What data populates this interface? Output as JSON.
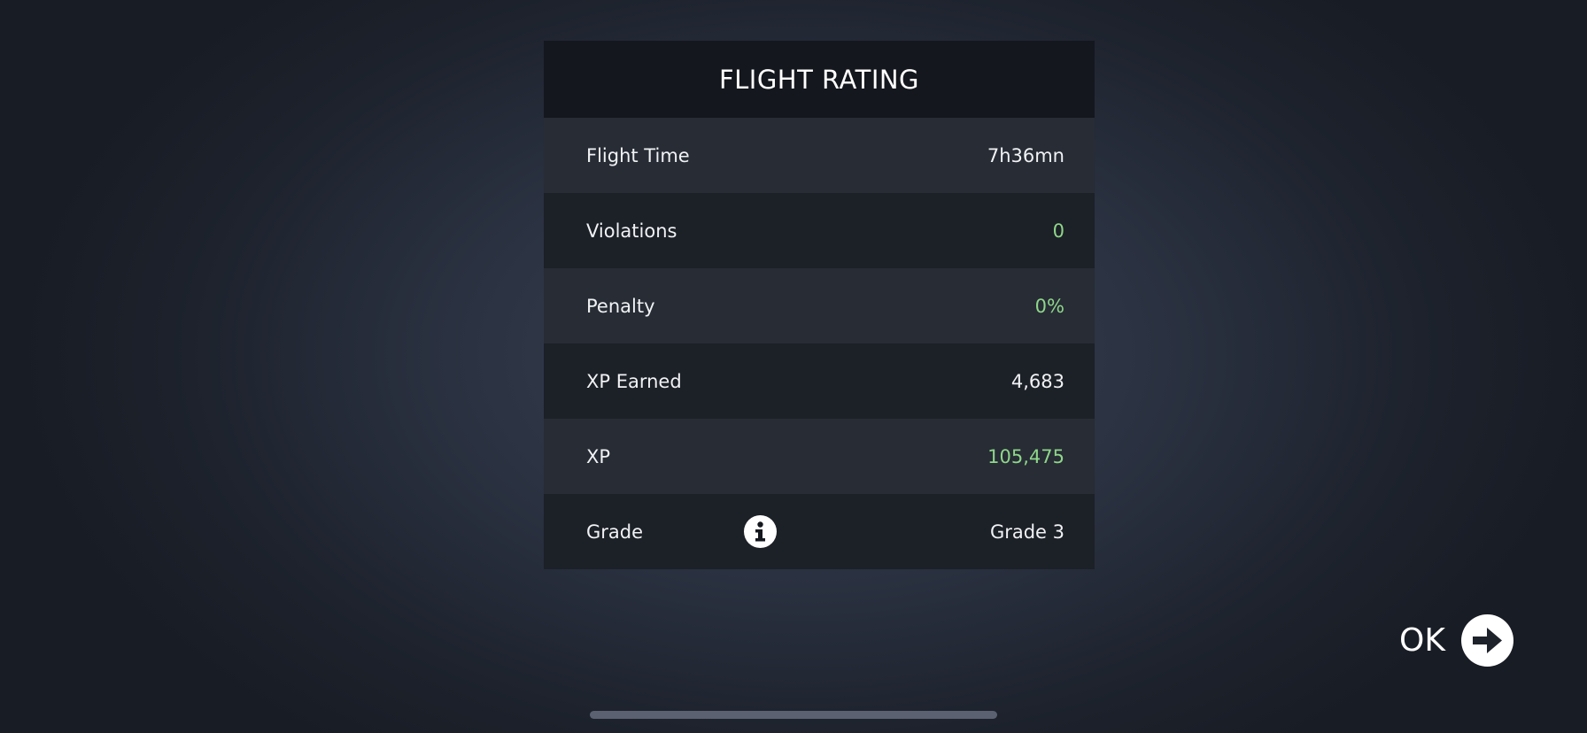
{
  "panel": {
    "title": "FLIGHT RATING",
    "rows": [
      {
        "label": "Flight Time",
        "value": "7h36mn",
        "value_color": "#f0f2f4"
      },
      {
        "label": "Violations",
        "value": "0",
        "value_color": "#8fd68a"
      },
      {
        "label": "Penalty",
        "value": "0%",
        "value_color": "#8fd68a"
      },
      {
        "label": "XP Earned",
        "value": "4,683",
        "value_color": "#f0f2f4"
      },
      {
        "label": "XP",
        "value": "105,475",
        "value_color": "#8fd68a"
      },
      {
        "label": "Grade",
        "value": "Grade 3",
        "value_color": "#f0f2f4",
        "icon": "info-icon"
      }
    ]
  },
  "ok_button": {
    "label": "OK",
    "icon": "arrow-right-icon"
  },
  "colors": {
    "positive_value": "#8fd68a",
    "header_bg": "#14171d",
    "row_light": "#272c35",
    "row_dark": "#1c2027"
  }
}
